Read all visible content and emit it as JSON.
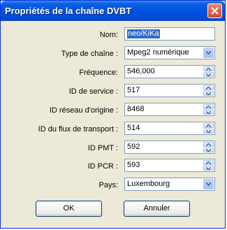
{
  "window": {
    "title": "Propriétés de la chaîne DVBT"
  },
  "form": {
    "name": {
      "label": "Nom:",
      "value": "neo/KiKa"
    },
    "channel_type": {
      "label": "Type de chaîne :",
      "value": "Mpeg2 numérique"
    },
    "frequency": {
      "label": "Fréquence:",
      "value": "546,000"
    },
    "service_id": {
      "label": "ID de service :",
      "value": "517"
    },
    "original_network_id": {
      "label": "ID réseau d'origine :",
      "value": "8468"
    },
    "transport_stream_id": {
      "label": "ID du flux de transport :",
      "value": "514"
    },
    "pmt_id": {
      "label": "ID PMT :",
      "value": "592"
    },
    "pcr_id": {
      "label": "ID PCR :",
      "value": "593"
    },
    "country": {
      "label": "Pays:",
      "value": "Luxembourg"
    }
  },
  "buttons": {
    "ok": "OK",
    "cancel": "Annuler"
  },
  "icons": {
    "close": "close-icon",
    "spin_up": "arrow-up-icon",
    "spin_down": "arrow-down-icon",
    "dropdown": "chevron-down-icon"
  }
}
